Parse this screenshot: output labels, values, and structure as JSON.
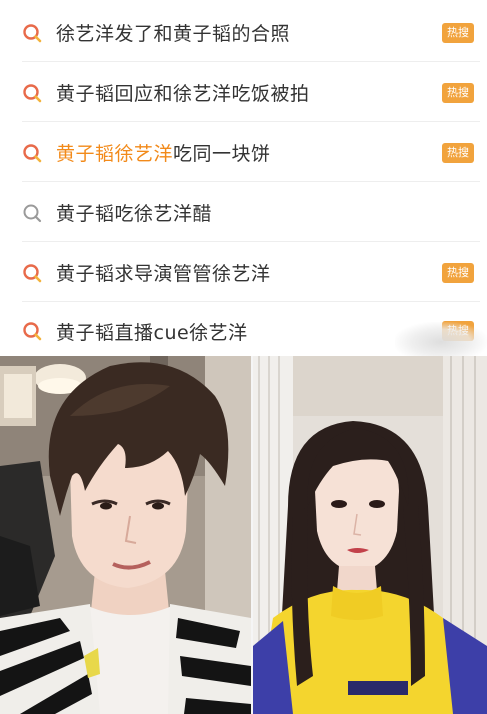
{
  "search_results": [
    {
      "pre": "",
      "highlight": "",
      "post": "徐艺洋发了和黄子韬的合照",
      "icon": "hot-search-icon",
      "badge": "热搜"
    },
    {
      "pre": "",
      "highlight": "",
      "post": "黄子韬回应和徐艺洋吃饭被拍",
      "icon": "hot-search-icon",
      "badge": "热搜"
    },
    {
      "pre": "",
      "highlight": "黄子韬徐艺洋",
      "post": "吃同一块饼",
      "icon": "hot-search-icon",
      "badge": "热搜"
    },
    {
      "pre": "",
      "highlight": "",
      "post": "黄子韬吃徐艺洋醋",
      "icon": "search-icon",
      "badge": ""
    },
    {
      "pre": "",
      "highlight": "",
      "post": "黄子韬求导演管管徐艺洋",
      "icon": "hot-search-icon",
      "badge": "热搜"
    },
    {
      "pre": "",
      "highlight": "",
      "post": "黄子韬直播cue徐艺洋",
      "icon": "hot-search-icon",
      "badge": "热搜"
    }
  ],
  "colors": {
    "highlight": "#f28a1a",
    "badge": "#f1a33d",
    "hot_icon": "#f28a1a",
    "plain_icon": "#999999"
  }
}
